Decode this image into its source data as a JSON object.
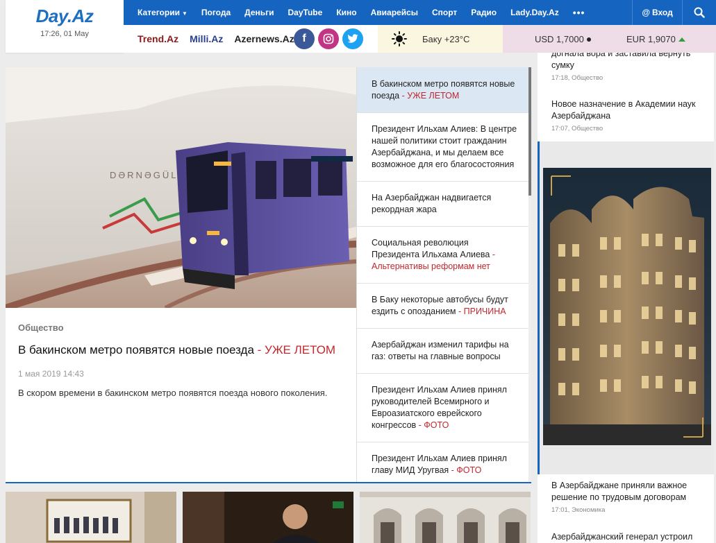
{
  "header": {
    "logo": "Day.Az",
    "datetime": "17:26, 01 May",
    "nav": [
      "Категории",
      "Погода",
      "Деньги",
      "DayTube",
      "Кино",
      "Авиарейсы",
      "Спорт",
      "Радио",
      "Lady.Day.Az"
    ],
    "more": "•••",
    "login": "Вход",
    "partners": [
      "Trend.Az",
      "Milli.Az",
      "Azernews.Az"
    ],
    "social": {
      "facebook": "f"
    },
    "weather": "Баку +23°C",
    "usd": "USD 1,7000",
    "eur": "EUR 1,9070"
  },
  "hero": {
    "category": "Общество",
    "title": "В бакинском метро появятся новые поезда",
    "title_accent": " - УЖЕ ЛЕТОМ",
    "date": "1 мая 2019 14:43",
    "lead": "В скором времени в бакинском метро появятся поезда нового поколения.",
    "image_sign": "DƏRNƏGÜL"
  },
  "news": [
    {
      "text": "В бакинском метро появятся новые поезда",
      "accent": " - УЖЕ ЛЕТОМ"
    },
    {
      "text": "Президент Ильхам Алиев: В центре нашей политики стоит гражданин Азербайджана, и мы делаем все возможное для его благосостояния",
      "accent": ""
    },
    {
      "text": "На Азербайджан надвигается рекордная жара",
      "accent": ""
    },
    {
      "text": "Социальная революция Президента Ильхама Алиева",
      "accent": " - Альтернативы реформам нет"
    },
    {
      "text": "В Баку некоторые автобусы будут ездить с опозданием",
      "accent": " - ПРИЧИНА"
    },
    {
      "text": "Азербайджан изменил тарифы на газ: ответы на главные вопросы",
      "accent": ""
    },
    {
      "text": "Президент Ильхам Алиев принял руководителей Всемирного и Евроазиатского еврейского конгрессов",
      "accent": " - ФОТО"
    },
    {
      "text": "Президент Ильхам Алиев принял главу МИД Уругвая",
      "accent": " - ФОТО"
    }
  ],
  "right": [
    {
      "title": "догнала вора и заставила вернуть сумку",
      "meta": "17:18, Общество"
    },
    {
      "title": "Новое назначение в Академии наук Азербайджана",
      "meta": "17:07, Общество"
    },
    {
      "title": "В Азербайджане приняли важное решение по трудовым договорам",
      "meta": "17:01, Экономика"
    },
    {
      "title": "Азербайджанский генерал устроил",
      "meta": ""
    }
  ]
}
